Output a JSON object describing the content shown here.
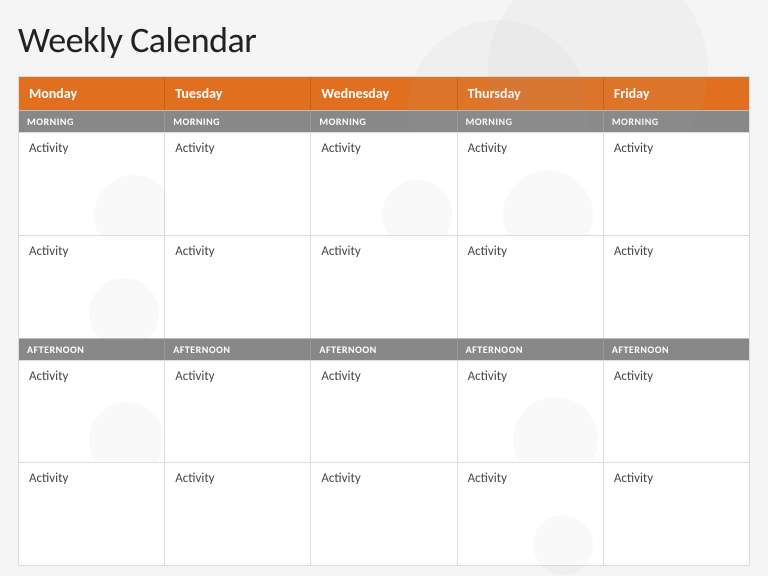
{
  "title": "Weekly Calendar",
  "days": [
    "Monday",
    "Tuesday",
    "Wednesday",
    "Thursday",
    "Friday"
  ],
  "sections": {
    "morning_label": "MORNING",
    "afternoon_label": "AFTERNOON"
  },
  "activity_label": "Activity",
  "rows": {
    "morning_row1": [
      "Activity",
      "Activity",
      "Activity",
      "Activity",
      "Activity"
    ],
    "morning_row2": [
      "Activity",
      "Activity",
      "Activity",
      "Activity",
      "Activity"
    ],
    "afternoon_row1": [
      "Activity",
      "Activity",
      "Activity",
      "Activity",
      "Activity"
    ],
    "afternoon_row2": [
      "Activity",
      "Activity",
      "Activity",
      "Activity",
      "Activity"
    ]
  }
}
